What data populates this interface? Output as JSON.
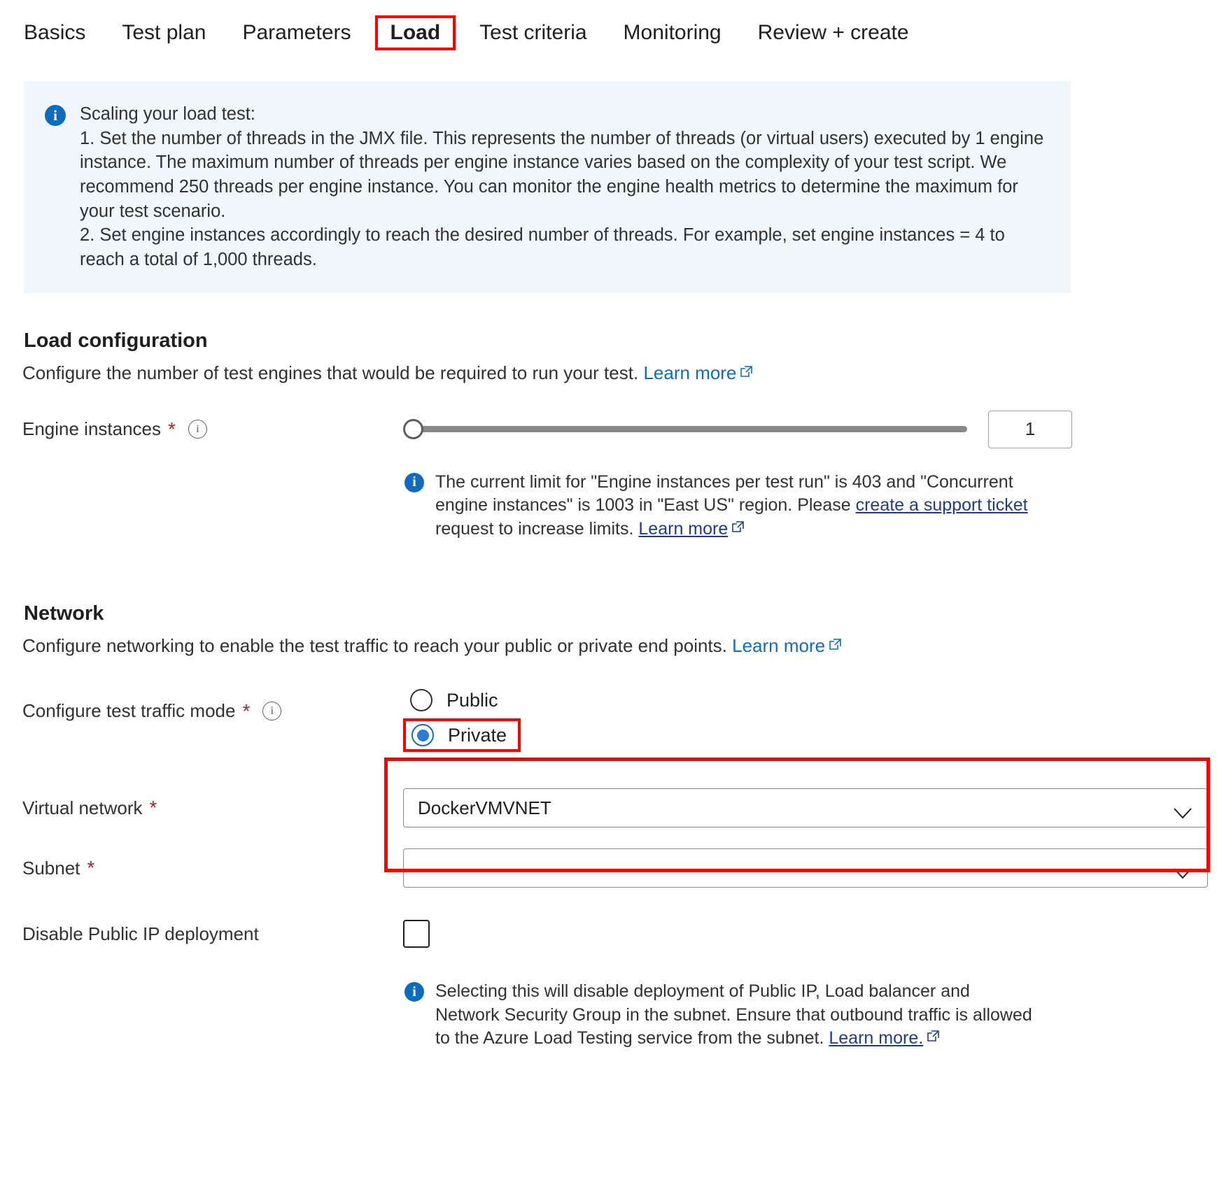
{
  "tabs": [
    {
      "label": "Basics",
      "selected": false
    },
    {
      "label": "Test plan",
      "selected": false
    },
    {
      "label": "Parameters",
      "selected": false
    },
    {
      "label": "Load",
      "selected": true
    },
    {
      "label": "Test criteria",
      "selected": false
    },
    {
      "label": "Monitoring",
      "selected": false
    },
    {
      "label": "Review + create",
      "selected": false
    }
  ],
  "banner": {
    "icon": "info-icon",
    "title": "Scaling your load test:",
    "line1": "1. Set the number of threads in the JMX file. This represents the number of threads (or virtual users) executed by 1 engine instance. The maximum number of threads per engine instance varies based on the complexity of your test script. We recommend 250 threads per engine instance. You can monitor the engine health metrics to determine the maximum for your test scenario.",
    "line2": "2. Set engine instances accordingly to reach the desired number of threads. For example, set engine instances = 4 to reach a total of 1,000 threads."
  },
  "load_configuration": {
    "heading": "Load configuration",
    "description": "Configure the number of test engines that would be required to run your test.",
    "learn_more": "Learn more",
    "engine_instances": {
      "label": "Configure the number of test engines",
      "field_label": "Engine instances",
      "required_marker": "*",
      "info_tooltip_icon": "info-circle-icon",
      "value": "1",
      "slider_min": 1,
      "slider_max": 403,
      "slider_position_percent": 0
    },
    "limit_note": {
      "icon": "info-icon",
      "text_part1": "The current limit for \"Engine instances per test run\" is 403 and \"Concurrent engine instances\" is 1003 in \"East US\" region. Please ",
      "link_support": "create a support ticket",
      "text_part2": " request to increase limits. ",
      "link_learn_more": "Learn more"
    }
  },
  "network": {
    "heading": "Network",
    "description": "Configure networking to enable the test traffic to reach your public or private end points.",
    "learn_more": "Learn more",
    "traffic_mode": {
      "field_label": "Configure test traffic mode",
      "required_marker": "*",
      "info_tooltip_icon": "info-circle-icon",
      "options": [
        {
          "label": "Public",
          "checked": false,
          "highlighted": false
        },
        {
          "label": "Private",
          "checked": true,
          "highlighted": true
        }
      ]
    },
    "virtual_network": {
      "field_label": "Virtual network",
      "required_marker": "*",
      "value": "DockerVMVNET",
      "chevron_icon": "chevron-down-icon"
    },
    "subnet": {
      "field_label": "Subnet",
      "required_marker": "*",
      "value": "",
      "chevron_icon": "chevron-down-icon"
    },
    "disable_public_ip": {
      "field_label": "Disable Public IP deployment",
      "checked": false
    },
    "disable_note": {
      "icon": "info-icon",
      "text": "Selecting this will disable deployment of Public IP, Load balancer and Network Security Group in the subnet. Ensure that outbound traffic is allowed to the Azure Load Testing service from the subnet. ",
      "link_learn_more": "Learn more."
    }
  },
  "colors": {
    "highlight_red": "#ff0000",
    "accent_blue": "#0f6cbd",
    "link_dark_blue": "#1f3c88",
    "required_red": "#a4262c",
    "banner_bg": "#eff6fc"
  }
}
